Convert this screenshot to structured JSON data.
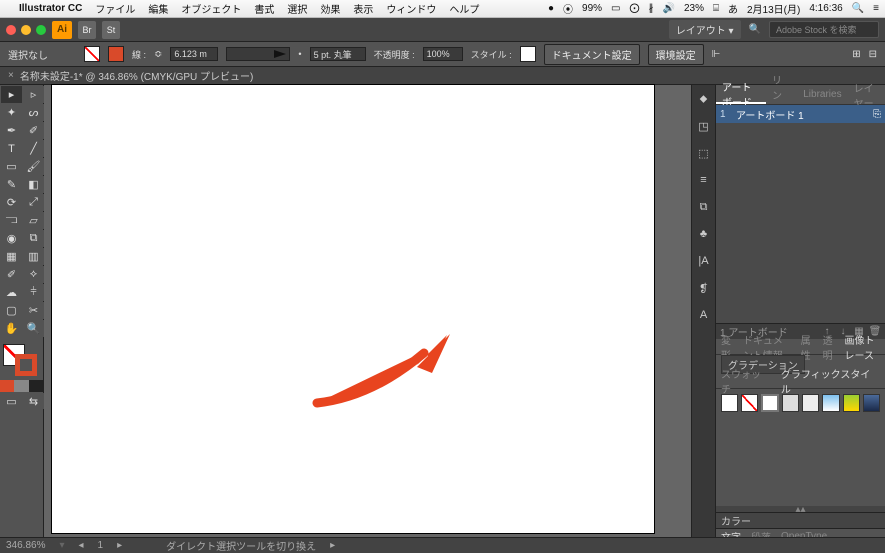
{
  "menubar": {
    "app": "Illustrator CC",
    "items": [
      "ファイル",
      "編集",
      "オブジェクト",
      "書式",
      "選択",
      "効果",
      "表示",
      "ウィンドウ",
      "ヘルプ"
    ],
    "status": {
      "memory": "99%",
      "battery": "23%",
      "date": "2月13日(月)",
      "time": "4:16:36"
    }
  },
  "topbar": {
    "ai": "Ai",
    "br": "Br",
    "st": "St",
    "layout": "レイアウト",
    "search_ph": "Adobe Stock を検索"
  },
  "control": {
    "selection": "選択なし",
    "stroke_label": "線 :",
    "stroke_w": "6.123 m",
    "profile": "5 pt. 丸筆",
    "opacity_label": "不透明度 :",
    "opacity": "100%",
    "style_label": "スタイル :",
    "docset": "ドキュメント設定",
    "prefs": "環境設定"
  },
  "doc": {
    "tab": "名称未設定-1* @ 346.86% (CMYK/GPU プレビュー)"
  },
  "artboards": {
    "tabs": [
      "アートボード",
      "リンク",
      "Libraries",
      "レイヤー"
    ],
    "items": [
      {
        "index": "1",
        "name": "アートボード 1"
      }
    ],
    "count": "1 アートボード"
  },
  "propTabs": [
    "変形",
    "ドキュメント情報",
    "属性",
    "透明",
    "画像トレース"
  ],
  "gradation": "グラデーション",
  "swatchTabs": [
    "スウォッチ",
    "グラフィックスタイル"
  ],
  "colorPanel": {
    "title": "カラー"
  },
  "footerTabs": [
    "文字",
    "段落",
    "OpenType"
  ],
  "status": {
    "zoom": "346.86%",
    "artnum": "1",
    "tool": "ダイレクト選択ツールを切り換え"
  },
  "tools": [
    [
      "select-tool",
      "▸",
      "direct-select-tool",
      "▹"
    ],
    [
      "magic-wand-tool",
      "✦",
      "lasso-tool",
      "ᔕ"
    ],
    [
      "pen-tool",
      "✒",
      "curvature-tool",
      "✐"
    ],
    [
      "type-tool",
      "T",
      "line-tool",
      "╱"
    ],
    [
      "rect-tool",
      "▭",
      "brush-tool",
      "🖌"
    ],
    [
      "shaper-tool",
      "✎",
      "eraser-tool",
      "◧"
    ],
    [
      "rotate-tool",
      "⟳",
      "scale-tool",
      "⤢"
    ],
    [
      "width-tool",
      "⫎",
      "free-transform-tool",
      "▱"
    ],
    [
      "shape-builder-tool",
      "◉",
      "perspective-tool",
      "⧉"
    ],
    [
      "mesh-tool",
      "▦",
      "gradient-tool",
      "▥"
    ],
    [
      "eyedropper-tool",
      "✐",
      "blend-tool",
      "⟡"
    ],
    [
      "symbol-tool",
      "☁",
      "graph-tool",
      "⫩"
    ],
    [
      "artboard-tool",
      "▢",
      "slice-tool",
      "✂"
    ],
    [
      "hand-tool",
      "✋",
      "zoom-tool",
      "🔍"
    ]
  ],
  "tabstrip": [
    "⬥",
    "◳",
    "⬚",
    "≡",
    "⧉",
    "♣",
    "|A",
    "❡",
    "A"
  ]
}
